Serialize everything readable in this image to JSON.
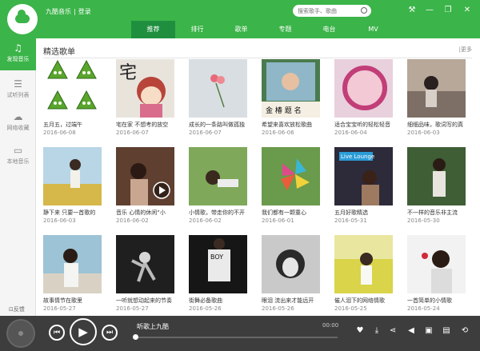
{
  "app": {
    "title": "九酷音乐",
    "login": "登录"
  },
  "search": {
    "placeholder": "搜索歌手、歌曲"
  },
  "nav": {
    "tabs": [
      "推荐",
      "排行",
      "歌单",
      "专题",
      "电台",
      "MV"
    ]
  },
  "sidebar": {
    "items": [
      "发现音乐",
      "试听列表",
      "网络收藏",
      "本地音乐"
    ],
    "feedback": "反馈"
  },
  "main": {
    "section_title": "精选歌单",
    "more": "|更多"
  },
  "cards": [
    {
      "title": "五月五，过端午",
      "date": "2016-06-08"
    },
    {
      "title": "宅在家 不想考的放空",
      "date": "2016-06-07"
    },
    {
      "title": "成长的一条路叫做孤独",
      "date": "2016-06-07"
    },
    {
      "title": "希望来喜欢放松歌曲",
      "date": "2016-06-06"
    },
    {
      "title": "适合宝宝听的轻松轻音",
      "date": "2016-06-04"
    },
    {
      "title": "细细品味，歌词写的真",
      "date": "2016-06-03"
    },
    {
      "title": "静下来 只要一首歌的",
      "date": "2016-06-03"
    },
    {
      "title": "音乐 心情的休闲“小",
      "date": "2016-06-02"
    },
    {
      "title": "小情歌，带走你的不开",
      "date": "2016-06-02"
    },
    {
      "title": "我们都有一颗童心",
      "date": "2016-06-01"
    },
    {
      "title": "五月好歌精选",
      "date": "2016-05-31"
    },
    {
      "title": "不一样的音乐非主流",
      "date": "2016-05-30"
    },
    {
      "title": "故事情节在歌里",
      "date": "2016-05-27"
    },
    {
      "title": "一听就想动起来的节奏",
      "date": "2016-05-27"
    },
    {
      "title": "街舞必备歌曲",
      "date": "2016-05-26"
    },
    {
      "title": "眼泪 流出来才能远开",
      "date": "2016-05-26"
    },
    {
      "title": "催人泪下的网络情歌",
      "date": "2016-05-25"
    },
    {
      "title": "一首简单的小情歌",
      "date": "2016-05-24"
    }
  ],
  "thumb_labels": {
    "c1": "宅",
    "c3": "金 椿 题 名",
    "c10": "Live Lounge",
    "c14": "BOY"
  },
  "player": {
    "title": "听歌上九酷",
    "time": "00:00"
  },
  "colors": {
    "brand": "#3bb449",
    "player_bg": "#3d3d3d"
  }
}
